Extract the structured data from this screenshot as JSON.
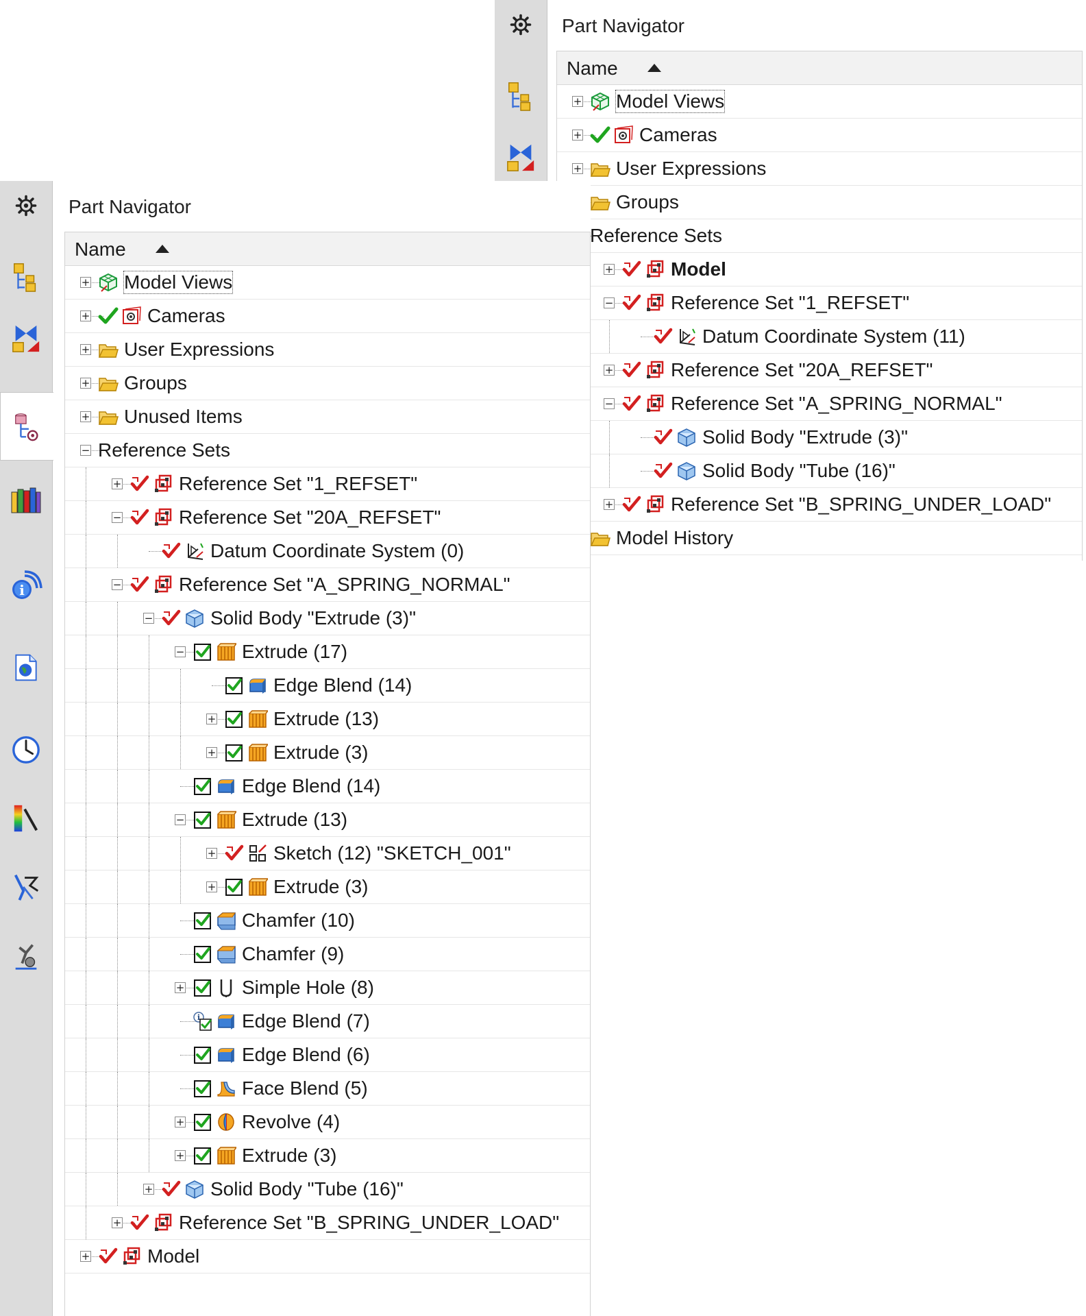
{
  "colors": {
    "sidebar_bg": "#dcdcdc",
    "check_green": "#1fa51f",
    "refset_red": "#d32020",
    "folder_yellow": "#f2c232"
  },
  "sidebar_icons_right": [
    "gear-icon",
    "assembly-navigator-icon",
    "constraint-navigator-icon",
    "part-navigator-icon",
    "reuse-library-icon",
    "hd3d-tools-icon",
    "web-browser-icon"
  ],
  "sidebar_icons_left": [
    "gear-icon",
    "assembly-navigator-icon",
    "constraint-navigator-icon",
    "part-navigator-icon",
    "reuse-library-icon",
    "hd3d-tools-icon",
    "web-browser-icon",
    "history-icon",
    "visualization-icon",
    "process-studio-icon",
    "roles-icon"
  ],
  "right_panel": {
    "title": "Part Navigator",
    "column_name": "Name",
    "rows": [
      {
        "label": "Model Views",
        "depth": 0,
        "tog": "+",
        "icons": [
          "views"
        ]
      },
      {
        "label": "Cameras",
        "depth": 0,
        "tog": "+",
        "icons": [
          "check",
          "camera"
        ]
      },
      {
        "label": "User Expressions",
        "depth": 0,
        "tog": "+",
        "icons": [
          "folder"
        ]
      },
      {
        "label": "Groups",
        "depth": 0,
        "tog": "+",
        "icons": [
          "folder"
        ]
      },
      {
        "label": "Reference Sets",
        "depth": 0,
        "tog": "-",
        "icons": []
      },
      {
        "label": "Model",
        "depth": 1,
        "tog": "+",
        "icons": [
          "redcheck",
          "refset"
        ],
        "bold": true
      },
      {
        "label": "Reference Set \"1_REFSET\"",
        "depth": 1,
        "tog": "-",
        "icons": [
          "redcheck",
          "refset"
        ]
      },
      {
        "label": "Datum Coordinate System (11)",
        "depth": 2,
        "tog": "",
        "icons": [
          "redcheck",
          "datum"
        ]
      },
      {
        "label": "Reference Set \"20A_REFSET\"",
        "depth": 1,
        "tog": "+",
        "icons": [
          "redcheck",
          "refset"
        ]
      },
      {
        "label": "Reference Set \"A_SPRING_NORMAL\"",
        "depth": 1,
        "tog": "-",
        "icons": [
          "redcheck",
          "refset"
        ]
      },
      {
        "label": "Solid Body \"Extrude (3)\"",
        "depth": 2,
        "tog": "",
        "icons": [
          "redcheck",
          "body"
        ]
      },
      {
        "label": "Solid Body \"Tube (16)\"",
        "depth": 2,
        "tog": "",
        "icons": [
          "redcheck",
          "body"
        ]
      },
      {
        "label": "Reference Set \"B_SPRING_UNDER_LOAD\"",
        "depth": 1,
        "tog": "+",
        "icons": [
          "redcheck",
          "refset"
        ]
      },
      {
        "label": "Model History",
        "depth": 0,
        "tog": "-",
        "icons": [
          "folder"
        ]
      }
    ]
  },
  "left_panel": {
    "title": "Part Navigator",
    "column_name": "Name",
    "rows": [
      {
        "label": "Model Views",
        "depth": 0,
        "tog": "+",
        "icons": [
          "views"
        ]
      },
      {
        "label": "Cameras",
        "depth": 0,
        "tog": "+",
        "icons": [
          "check",
          "camera"
        ]
      },
      {
        "label": "User Expressions",
        "depth": 0,
        "tog": "+",
        "icons": [
          "folder"
        ]
      },
      {
        "label": "Groups",
        "depth": 0,
        "tog": "+",
        "icons": [
          "folder"
        ]
      },
      {
        "label": "Unused Items",
        "depth": 0,
        "tog": "+",
        "icons": [
          "folder"
        ]
      },
      {
        "label": "Reference Sets",
        "depth": 0,
        "tog": "-",
        "icons": []
      },
      {
        "label": "Reference Set \"1_REFSET\"",
        "depth": 1,
        "tog": "+",
        "icons": [
          "redcheck",
          "refset"
        ]
      },
      {
        "label": "Reference Set \"20A_REFSET\"",
        "depth": 1,
        "tog": "-",
        "icons": [
          "redcheck",
          "refset"
        ]
      },
      {
        "label": "Datum Coordinate System (0)",
        "depth": 2,
        "tog": "",
        "icons": [
          "redcheck",
          "datum"
        ]
      },
      {
        "label": "Reference Set \"A_SPRING_NORMAL\"",
        "depth": 1,
        "tog": "-",
        "icons": [
          "redcheck",
          "refset"
        ]
      },
      {
        "label": "Solid Body \"Extrude (3)\"",
        "depth": 2,
        "tog": "-",
        "icons": [
          "redcheck",
          "body"
        ]
      },
      {
        "label": "Extrude (17)",
        "depth": 3,
        "tog": "-",
        "icons": [
          "box",
          "extrude"
        ]
      },
      {
        "label": "Edge Blend (14)",
        "depth": 4,
        "tog": "",
        "icons": [
          "box",
          "blend"
        ]
      },
      {
        "label": "Extrude (13)",
        "depth": 4,
        "tog": "+",
        "icons": [
          "box",
          "extrude"
        ]
      },
      {
        "label": "Extrude (3)",
        "depth": 4,
        "tog": "+",
        "icons": [
          "box",
          "extrude"
        ]
      },
      {
        "label": "Edge Blend (14)",
        "depth": 3,
        "tog": "",
        "icons": [
          "box",
          "blend"
        ]
      },
      {
        "label": "Extrude (13)",
        "depth": 3,
        "tog": "-",
        "icons": [
          "box",
          "extrude"
        ]
      },
      {
        "label": "Sketch (12) \"SKETCH_001\"",
        "depth": 4,
        "tog": "+",
        "icons": [
          "redcheck",
          "sketch"
        ]
      },
      {
        "label": "Extrude (3)",
        "depth": 4,
        "tog": "+",
        "icons": [
          "box",
          "extrude"
        ]
      },
      {
        "label": "Chamfer (10)",
        "depth": 3,
        "tog": "",
        "icons": [
          "box",
          "chamfer"
        ]
      },
      {
        "label": "Chamfer (9)",
        "depth": 3,
        "tog": "",
        "icons": [
          "box",
          "chamfer"
        ]
      },
      {
        "label": "Simple Hole (8)",
        "depth": 3,
        "tog": "+",
        "icons": [
          "box",
          "hole"
        ]
      },
      {
        "label": "Edge Blend (7)",
        "depth": 3,
        "tog": "",
        "icons": [
          "infobox",
          "blend"
        ]
      },
      {
        "label": "Edge Blend (6)",
        "depth": 3,
        "tog": "",
        "icons": [
          "box",
          "blend"
        ]
      },
      {
        "label": "Face Blend (5)",
        "depth": 3,
        "tog": "",
        "icons": [
          "box",
          "faceblend"
        ]
      },
      {
        "label": "Revolve (4)",
        "depth": 3,
        "tog": "+",
        "icons": [
          "box",
          "revolve"
        ]
      },
      {
        "label": "Extrude (3)",
        "depth": 3,
        "tog": "+",
        "icons": [
          "box",
          "extrude"
        ]
      },
      {
        "label": "Solid Body \"Tube (16)\"",
        "depth": 2,
        "tog": "+",
        "icons": [
          "redcheck",
          "body"
        ]
      },
      {
        "label": "Reference Set \"B_SPRING_UNDER_LOAD\"",
        "depth": 1,
        "tog": "+",
        "icons": [
          "redcheck",
          "refset"
        ]
      },
      {
        "label": "Model",
        "depth": 0,
        "tog": "+",
        "icons": [
          "redcheck",
          "refset"
        ]
      }
    ]
  }
}
